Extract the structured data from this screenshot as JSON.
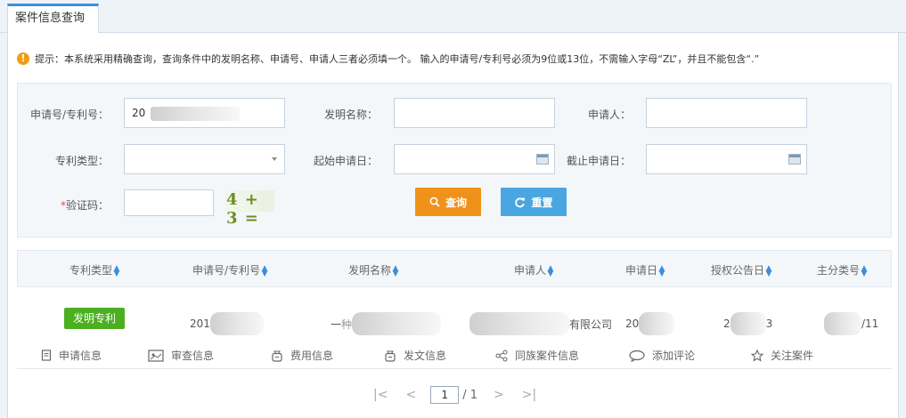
{
  "tab": {
    "title": "案件信息查询"
  },
  "tip": {
    "text": "提示：本系统采用精确查询，查询条件中的发明名称、申请号、申请人三者必须填一个。 输入的申请号/专利号必须为9位或13位，不需输入字母“ZL”，并且不能包含“.”"
  },
  "form": {
    "app_no_label": "申请号/专利号：",
    "app_no_value": "20",
    "invention_label": "发明名称：",
    "applicant_label": "申请人：",
    "type_label": "专利类型：",
    "start_date_label": "起始申请日：",
    "end_date_label": "截止申请日：",
    "captcha_req": "*",
    "captcha_label": "验证码：",
    "captcha_text": "4 + 3 =",
    "search_label": "查询",
    "reset_label": "重置"
  },
  "table": {
    "headers": [
      "专利类型",
      "申请号/专利号",
      "发明名称",
      "申请人",
      "申请日",
      "授权公告日",
      "主分类号"
    ],
    "row": {
      "type_badge": "发明专利",
      "app_no": "201",
      "title_prefix": "一",
      "title_frag": "种",
      "applicant_suffix": "有限公司",
      "app_date": "20",
      "grant_date_a": "2",
      "grant_date_b": "3",
      "class_suffix": "/11"
    }
  },
  "actions": [
    "申请信息",
    "审查信息",
    "费用信息",
    "发文信息",
    "同族案件信息",
    "添加评论",
    "关注案件"
  ],
  "pager": {
    "first": "|<",
    "prev": "<",
    "current": "1",
    "total": "/ 1",
    "next": ">",
    "last": ">|"
  },
  "colors": {
    "accent": "#3b8ed8",
    "search_btn": "#f0921a",
    "reset_btn": "#4aa6e0",
    "badge": "#4caf20",
    "required": "#e74c3c"
  }
}
